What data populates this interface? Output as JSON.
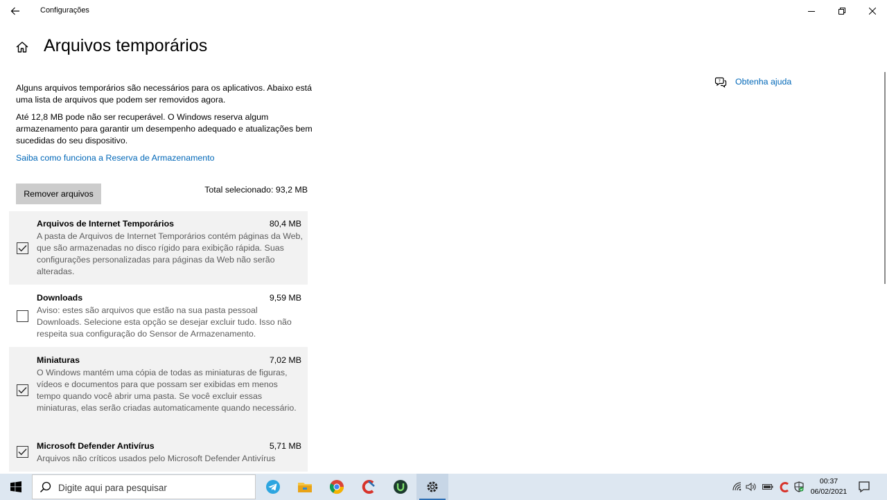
{
  "window": {
    "app_title": "Configurações"
  },
  "header": {
    "title": "Arquivos temporários"
  },
  "intro": {
    "para1": "Alguns arquivos temporários são necessários para os aplicativos. Abaixo está uma lista de arquivos que podem ser removidos agora.",
    "para2": "Até 12,8 MB pode não ser recuperável. O Windows reserva algum armazenamento para garantir um desempenho adequado e atualizações bem sucedidas do seu dispositivo.",
    "link": "Saiba como funciona a Reserva de Armazenamento"
  },
  "actions": {
    "remove_label": "Remover arquivos",
    "total_selected": "Total selecionado: 93,2 MB"
  },
  "items": [
    {
      "name": "Arquivos de Internet Temporários",
      "size": "80,4 MB",
      "checked": true,
      "description": "A pasta de Arquivos de Internet Temporários contém páginas da Web, que são armazenadas no disco rígido para exibição rápida. Suas configurações personalizadas para páginas da Web não serão alteradas."
    },
    {
      "name": "Downloads",
      "size": "9,59 MB",
      "checked": false,
      "description": "Aviso: estes são arquivos que estão na sua pasta pessoal Downloads. Selecione esta opção se desejar excluir tudo. Isso não respeita sua configuração do Sensor de Armazenamento."
    },
    {
      "name": "Miniaturas",
      "size": "7,02 MB",
      "checked": true,
      "description": "O Windows mantém uma cópia de todas as miniaturas de figuras, vídeos e documentos para que possam ser exibidas em menos tempo quando você abrir uma pasta. Se você excluir essas miniaturas, elas serão criadas automaticamente quando necessário."
    },
    {
      "name": "Microsoft Defender Antivírus",
      "size": "5,71 MB",
      "checked": true,
      "description": "Arquivos não críticos usados pelo Microsoft Defender Antivírus"
    }
  ],
  "help": {
    "label": "Obtenha ajuda"
  },
  "taskbar": {
    "search_placeholder": "Digite aqui para pesquisar",
    "apps": [
      "telegram-icon",
      "file-explorer-icon",
      "chrome-icon",
      "ccleaner-icon",
      "utorrent-icon",
      "settings-icon"
    ],
    "time": "00:37",
    "date": "06/02/2021"
  },
  "colors": {
    "accent": "#0067b8",
    "selected_row": "#f2f2f2",
    "taskbar": "#dde7f1",
    "button": "#cccccc"
  }
}
